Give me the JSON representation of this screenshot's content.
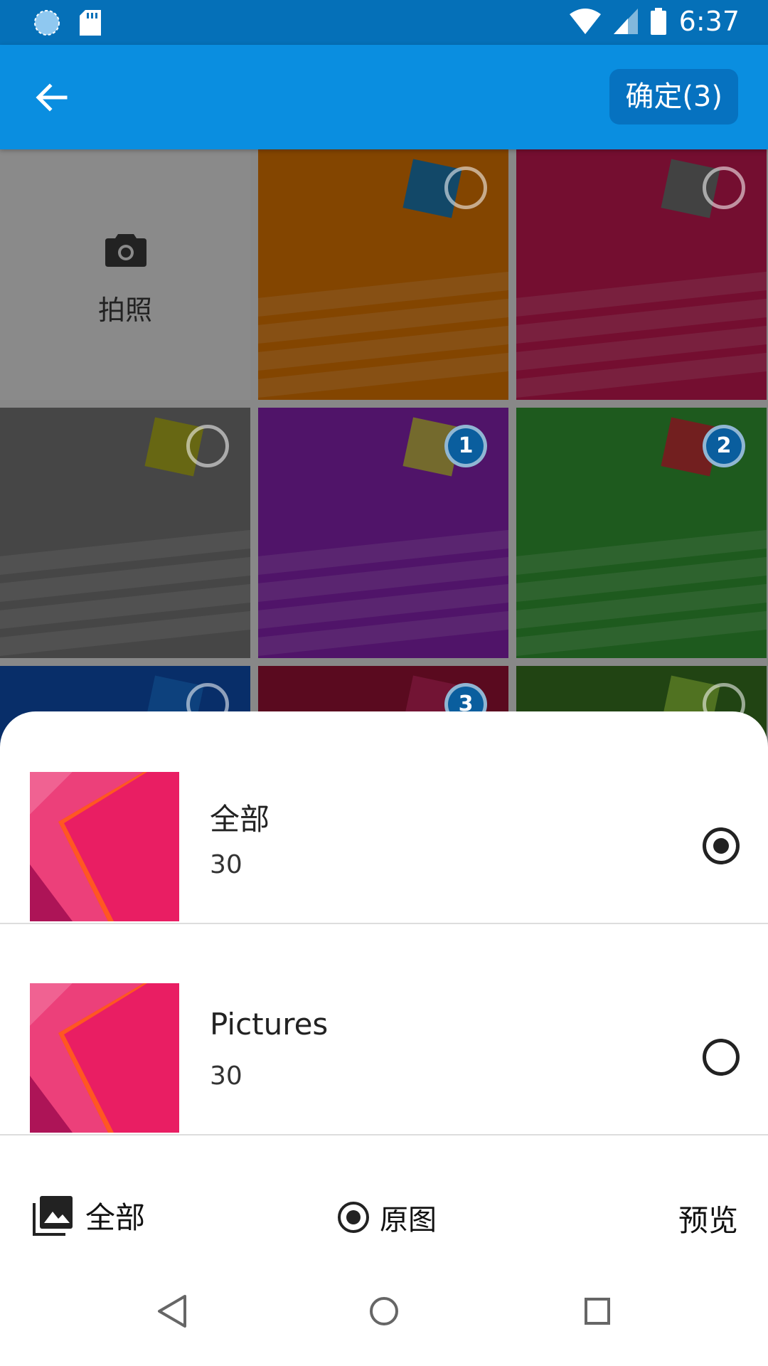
{
  "status_bar": {
    "time": "6:37"
  },
  "app_bar": {
    "confirm_label": "确定(3)"
  },
  "grid": {
    "camera_label": "拍照",
    "cells": [
      {
        "color": "#c96a00",
        "tile": "#1d6fa0",
        "selected": false,
        "badge": ""
      },
      {
        "color": "#b2164a",
        "tile": "#666666",
        "selected": false,
        "badge": ""
      },
      {
        "color": "#6c6c6c",
        "tile": "#9e9e1e",
        "selected": false,
        "badge": ""
      },
      {
        "color": "#7b1fa2",
        "tile": "#b3a346",
        "selected": true,
        "badge": "1"
      },
      {
        "color": "#2e8b2e",
        "tile": "#b03030",
        "selected": true,
        "badge": "2"
      },
      {
        "color": "#0d47a1",
        "tile": "#1565c0",
        "selected": false,
        "badge": ""
      },
      {
        "color": "#8b1030",
        "tile": "#b02050",
        "selected": true,
        "badge": "3"
      },
      {
        "color": "#33691e",
        "tile": "#7caf34",
        "selected": false,
        "badge": ""
      }
    ]
  },
  "albums": [
    {
      "name": "全部",
      "count": "30",
      "selected": true
    },
    {
      "name": "Pictures",
      "count": "30",
      "selected": false
    }
  ],
  "bottom_bar": {
    "all_label": "全部",
    "original_label": "原图",
    "preview_label": "预览"
  },
  "colors": {
    "primary": "#0a8ee0",
    "primary_dark": "#0570b8",
    "accent_pink": "#e91e63"
  }
}
